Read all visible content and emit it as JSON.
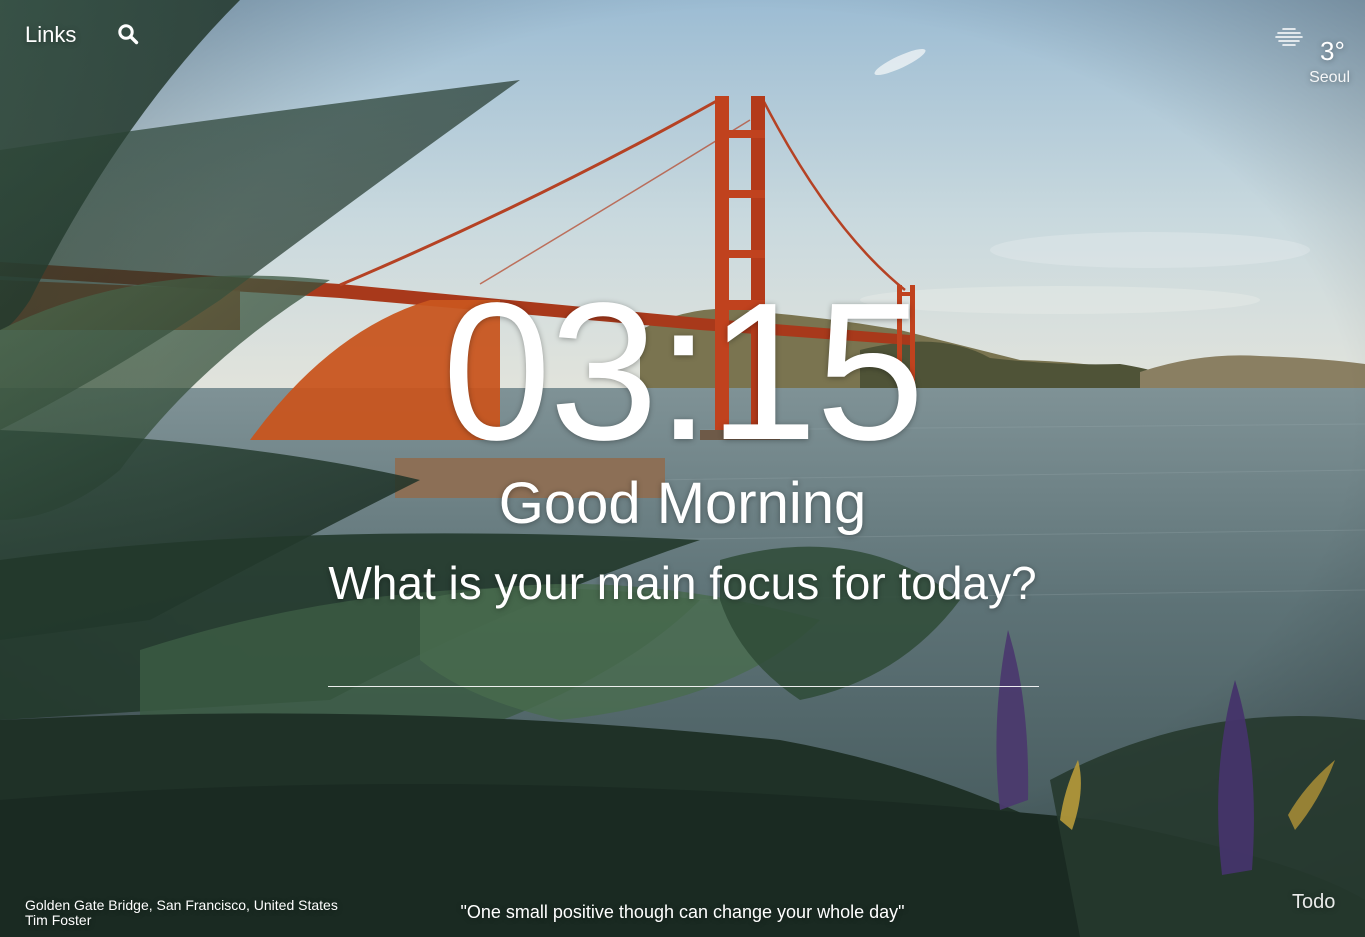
{
  "header": {
    "links_label": "Links",
    "search_icon": "search-icon"
  },
  "weather": {
    "icon": "fog-icon",
    "temperature": "3°",
    "city": "Seoul"
  },
  "main": {
    "time": "03:15",
    "greeting": "Good Morning",
    "focus_question": "What is your main focus for today?",
    "focus_input_value": ""
  },
  "footer": {
    "photo_title": "Golden Gate Bridge, San Francisco, United States",
    "photo_author": "Tim Foster",
    "quote": "\"One small positive though can change your whole day\"",
    "todo_label": "Todo"
  },
  "colors": {
    "bridge": "#c0421e",
    "sky_top": "#9fbdd2",
    "sky_bottom": "#dbe6e4",
    "water": "#5f7478",
    "foliage": "#203329"
  }
}
